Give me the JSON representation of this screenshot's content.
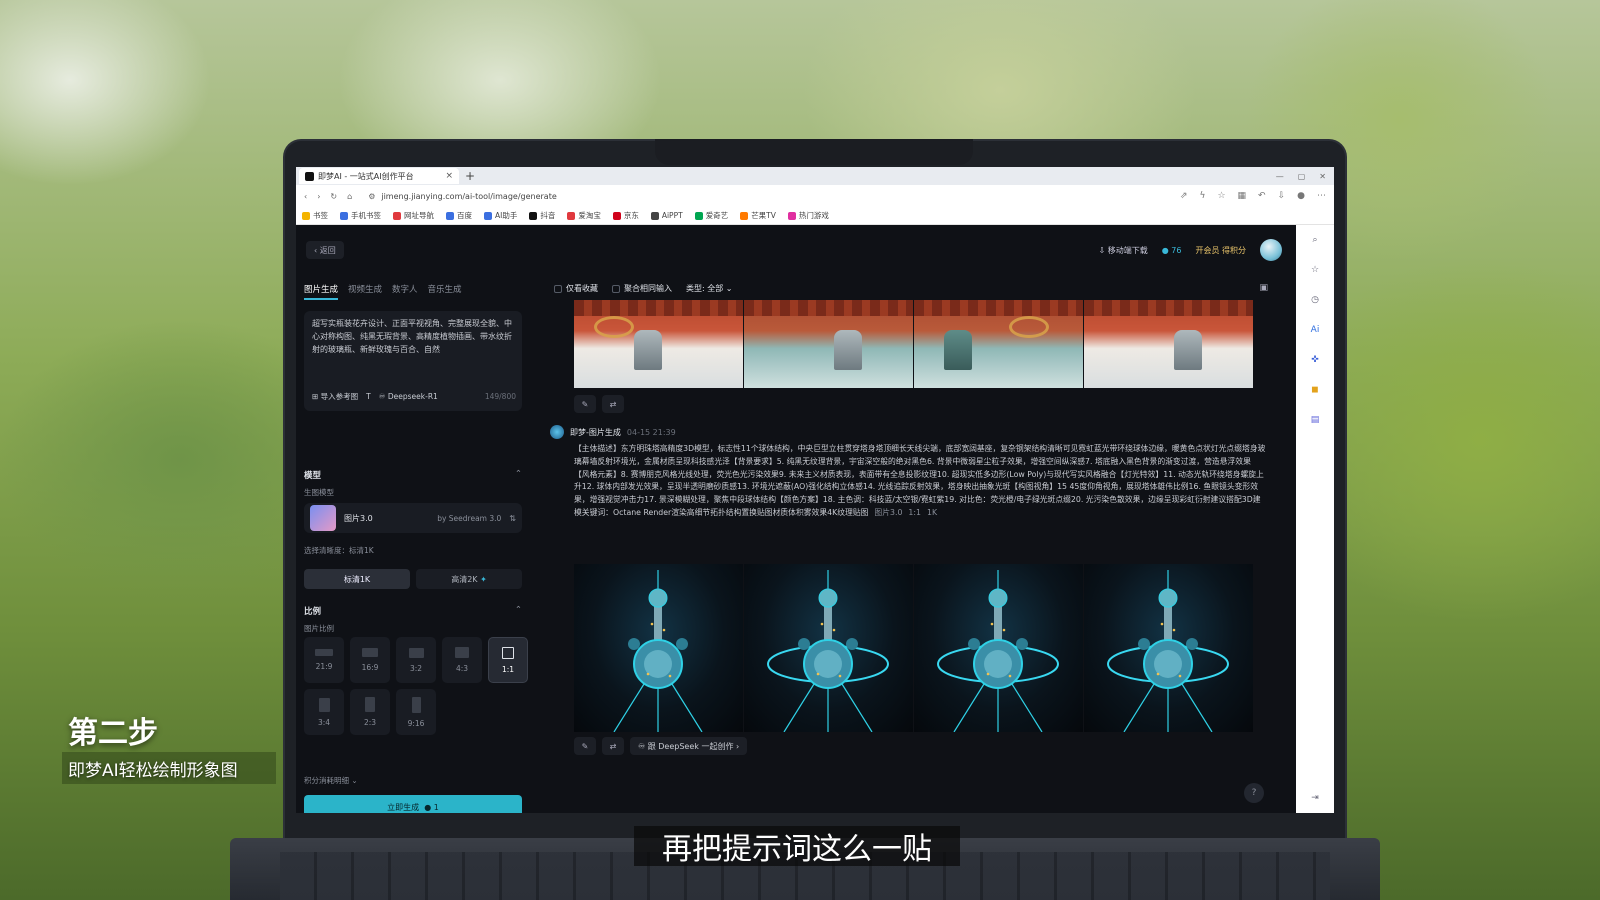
{
  "browser": {
    "tab_title": "即梦AI - 一站式AI创作平台",
    "url": "jimeng.jianying.com/ai-tool/image/generate",
    "bookmarks": [
      "书签",
      "手机书签",
      "网址导航",
      "百度",
      "AI助手",
      "抖音",
      "爱淘宝",
      "京东",
      "AiPPT",
      "爱奇艺",
      "芒果TV",
      "热门游戏"
    ]
  },
  "app": {
    "back_label": "返回",
    "mobile_download": "移动端下载",
    "credits": "76",
    "vip_label": "开会员 得积分",
    "mode_tabs": [
      "图片生成",
      "视频生成",
      "数字人",
      "音乐生成"
    ],
    "prompt_text": "超写实瓶装花卉设计、正面平视视角、完整展现全貌、中心对称构图、纯黑无瑕背景、高精度植物插画、带水纹折射的玻璃瓶、新鲜玫瑰与百合、自然",
    "import_ref": "导入参考图",
    "deepseek_label": "Deepseek-R1",
    "char_count": "149/800",
    "model_section": "模型",
    "model_sub": "生图模型",
    "model_name": "图片3.0",
    "model_by": "by Seedream 3.0",
    "clarity_label": "选择清晰度：标清1K",
    "res_options": [
      "标清1K",
      "高清2K"
    ],
    "ratio_section": "比例",
    "ratio_sub": "图片比例",
    "ratios": [
      "21:9",
      "16:9",
      "3:2",
      "4:3",
      "1:1",
      "3:4",
      "2:3",
      "9:16"
    ],
    "selected_ratio": "1:1",
    "points_detail": "积分消耗明细",
    "generate_label": "立即生成",
    "generate_cost": "1"
  },
  "feed": {
    "filter_fav": "仅看收藏",
    "filter_merge": "聚合相同输入",
    "filter_type": "类型: 全部",
    "entry_author": "即梦-图片生成",
    "entry_time": "04-15  21:39",
    "entry_desc": "【主体描述】东方明珠塔高精度3D模型，标志性11个球体结构，中央巨型立柱贯穿塔身塔顶细长天线尖端，底部宽阔基座，复杂钢架结构清晰可见霓虹蓝光带环绕球体边缘，暖黄色点状灯光点缀塔身玻璃幕墙反射环境光，金属材质呈现科技感光泽【背景要求】5. 纯黑无纹理背景，宇宙深空般的绝对黑色6. 背景中微弱星尘粒子效果，增强空间纵深感7. 塔底融入黑色背景的渐变过渡，营造悬浮效果【风格元素】8. 赛博朋克风格光线处理，荧光色光污染效果9. 未来主义材质表现，表面带有全息投影纹理10. 超现实低多边形(Low Poly)与现代写实风格融合【灯光特效】11. 动态光轨环绕塔身螺旋上升12. 球体内部发光效果，呈现半透明磨砂质感13. 环境光遮蔽(AO)强化结构立体感14. 光线追踪反射效果，塔身映出抽象光斑【构图视角】15 45度仰角视角，展现塔体雄伟比例16. 鱼眼镜头变形效果，增强视觉冲击力17. 景深模糊处理，聚焦中段球体结构【颜色方案】18. 主色调：科技蓝/太空银/霓虹紫19. 对比色：荧光橙/电子绿光斑点缀20. 光污染色散效果，边缘呈现彩虹衍射建议搭配3D建模关键词：Octane Render渲染高细节拓扑结构置换贴图材质体积雾效果4K纹理贴图",
    "entry_tags": [
      "图片3.0",
      "1:1",
      "1K"
    ],
    "deepseek_cta": "跟 DeepSeek 一起创作"
  },
  "overlay": {
    "step_title": "第二步",
    "step_sub": "即梦AI轻松绘制形象图",
    "caption": "再把提示词这么一贴"
  },
  "colors": {
    "accent": "#2bb4c9",
    "panel": "#0f1116",
    "vip": "#e9c46a"
  }
}
